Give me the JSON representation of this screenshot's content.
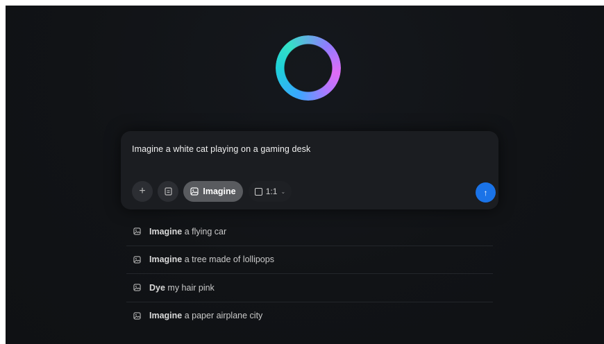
{
  "logo": {
    "icon": "copilot-ring-icon"
  },
  "composer": {
    "prompt_text": "Imagine a white cat playing on a gaming desk",
    "add_icon": "+",
    "file_icon": "file-icon",
    "imagine_label": "Imagine",
    "ratio_label": "1:1",
    "ratio_chevron": "⌄",
    "send_icon": "↑"
  },
  "suggestions": [
    {
      "bold": "Imagine",
      "rest": " a flying car"
    },
    {
      "bold": "Imagine",
      "rest": " a tree made of lollipops"
    },
    {
      "bold": "Dye",
      "rest": " my hair pink"
    },
    {
      "bold": "Imagine",
      "rest": " a paper airplane city"
    }
  ],
  "colors": {
    "background": "#111316",
    "composer": "#1b1d21",
    "imagine_active": "#595b5f",
    "send_button": "#1a73e8"
  }
}
